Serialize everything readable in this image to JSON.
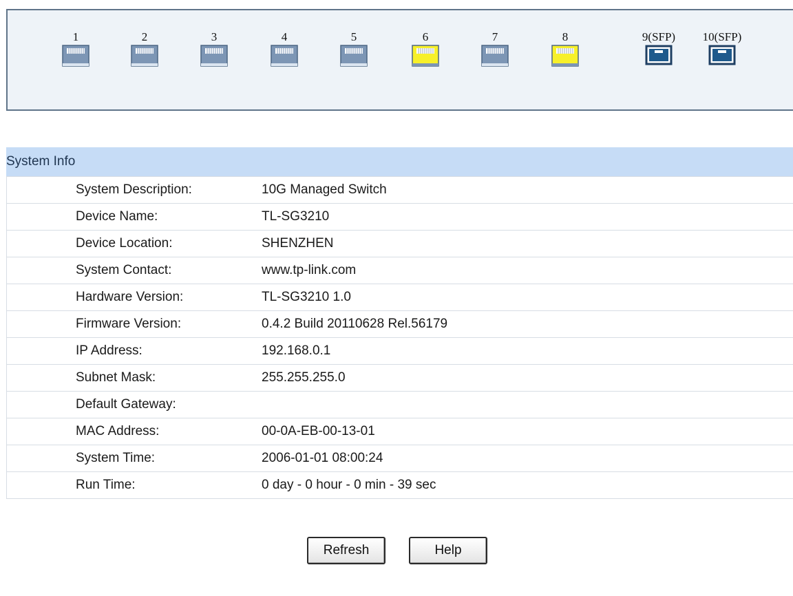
{
  "ports": [
    {
      "label": "1",
      "type": "rj45",
      "status": "down"
    },
    {
      "label": "2",
      "type": "rj45",
      "status": "down"
    },
    {
      "label": "3",
      "type": "rj45",
      "status": "down"
    },
    {
      "label": "4",
      "type": "rj45",
      "status": "down"
    },
    {
      "label": "5",
      "type": "rj45",
      "status": "down"
    },
    {
      "label": "6",
      "type": "rj45",
      "status": "up"
    },
    {
      "label": "7",
      "type": "rj45",
      "status": "down"
    },
    {
      "label": "8",
      "type": "rj45",
      "status": "up"
    },
    {
      "label": "9(SFP)",
      "type": "sfp",
      "status": "down"
    },
    {
      "label": "10(SFP)",
      "type": "sfp",
      "status": "down"
    }
  ],
  "colors": {
    "port_up": "#f7f02a",
    "port_down": "#7d96b5",
    "header_bg": "#c6dcf6"
  },
  "system_info": {
    "title": "System Info",
    "rows": [
      {
        "label": "System Description:",
        "value": "10G Managed Switch"
      },
      {
        "label": "Device Name:",
        "value": "TL-SG3210"
      },
      {
        "label": "Device Location:",
        "value": "SHENZHEN"
      },
      {
        "label": "System Contact:",
        "value": "www.tp-link.com"
      },
      {
        "label": "Hardware Version:",
        "value": "TL-SG3210 1.0"
      },
      {
        "label": "Firmware Version:",
        "value": "0.4.2 Build 20110628 Rel.56179"
      },
      {
        "label": "IP Address:",
        "value": "192.168.0.1"
      },
      {
        "label": "Subnet Mask:",
        "value": "255.255.255.0"
      },
      {
        "label": "Default Gateway:",
        "value": ""
      },
      {
        "label": "MAC Address:",
        "value": "00-0A-EB-00-13-01"
      },
      {
        "label": "System Time:",
        "value": "2006-01-01 08:00:24"
      },
      {
        "label": "Run Time:",
        "value": "0 day - 0 hour - 0 min - 39 sec"
      }
    ]
  },
  "buttons": {
    "refresh": "Refresh",
    "help": "Help"
  }
}
